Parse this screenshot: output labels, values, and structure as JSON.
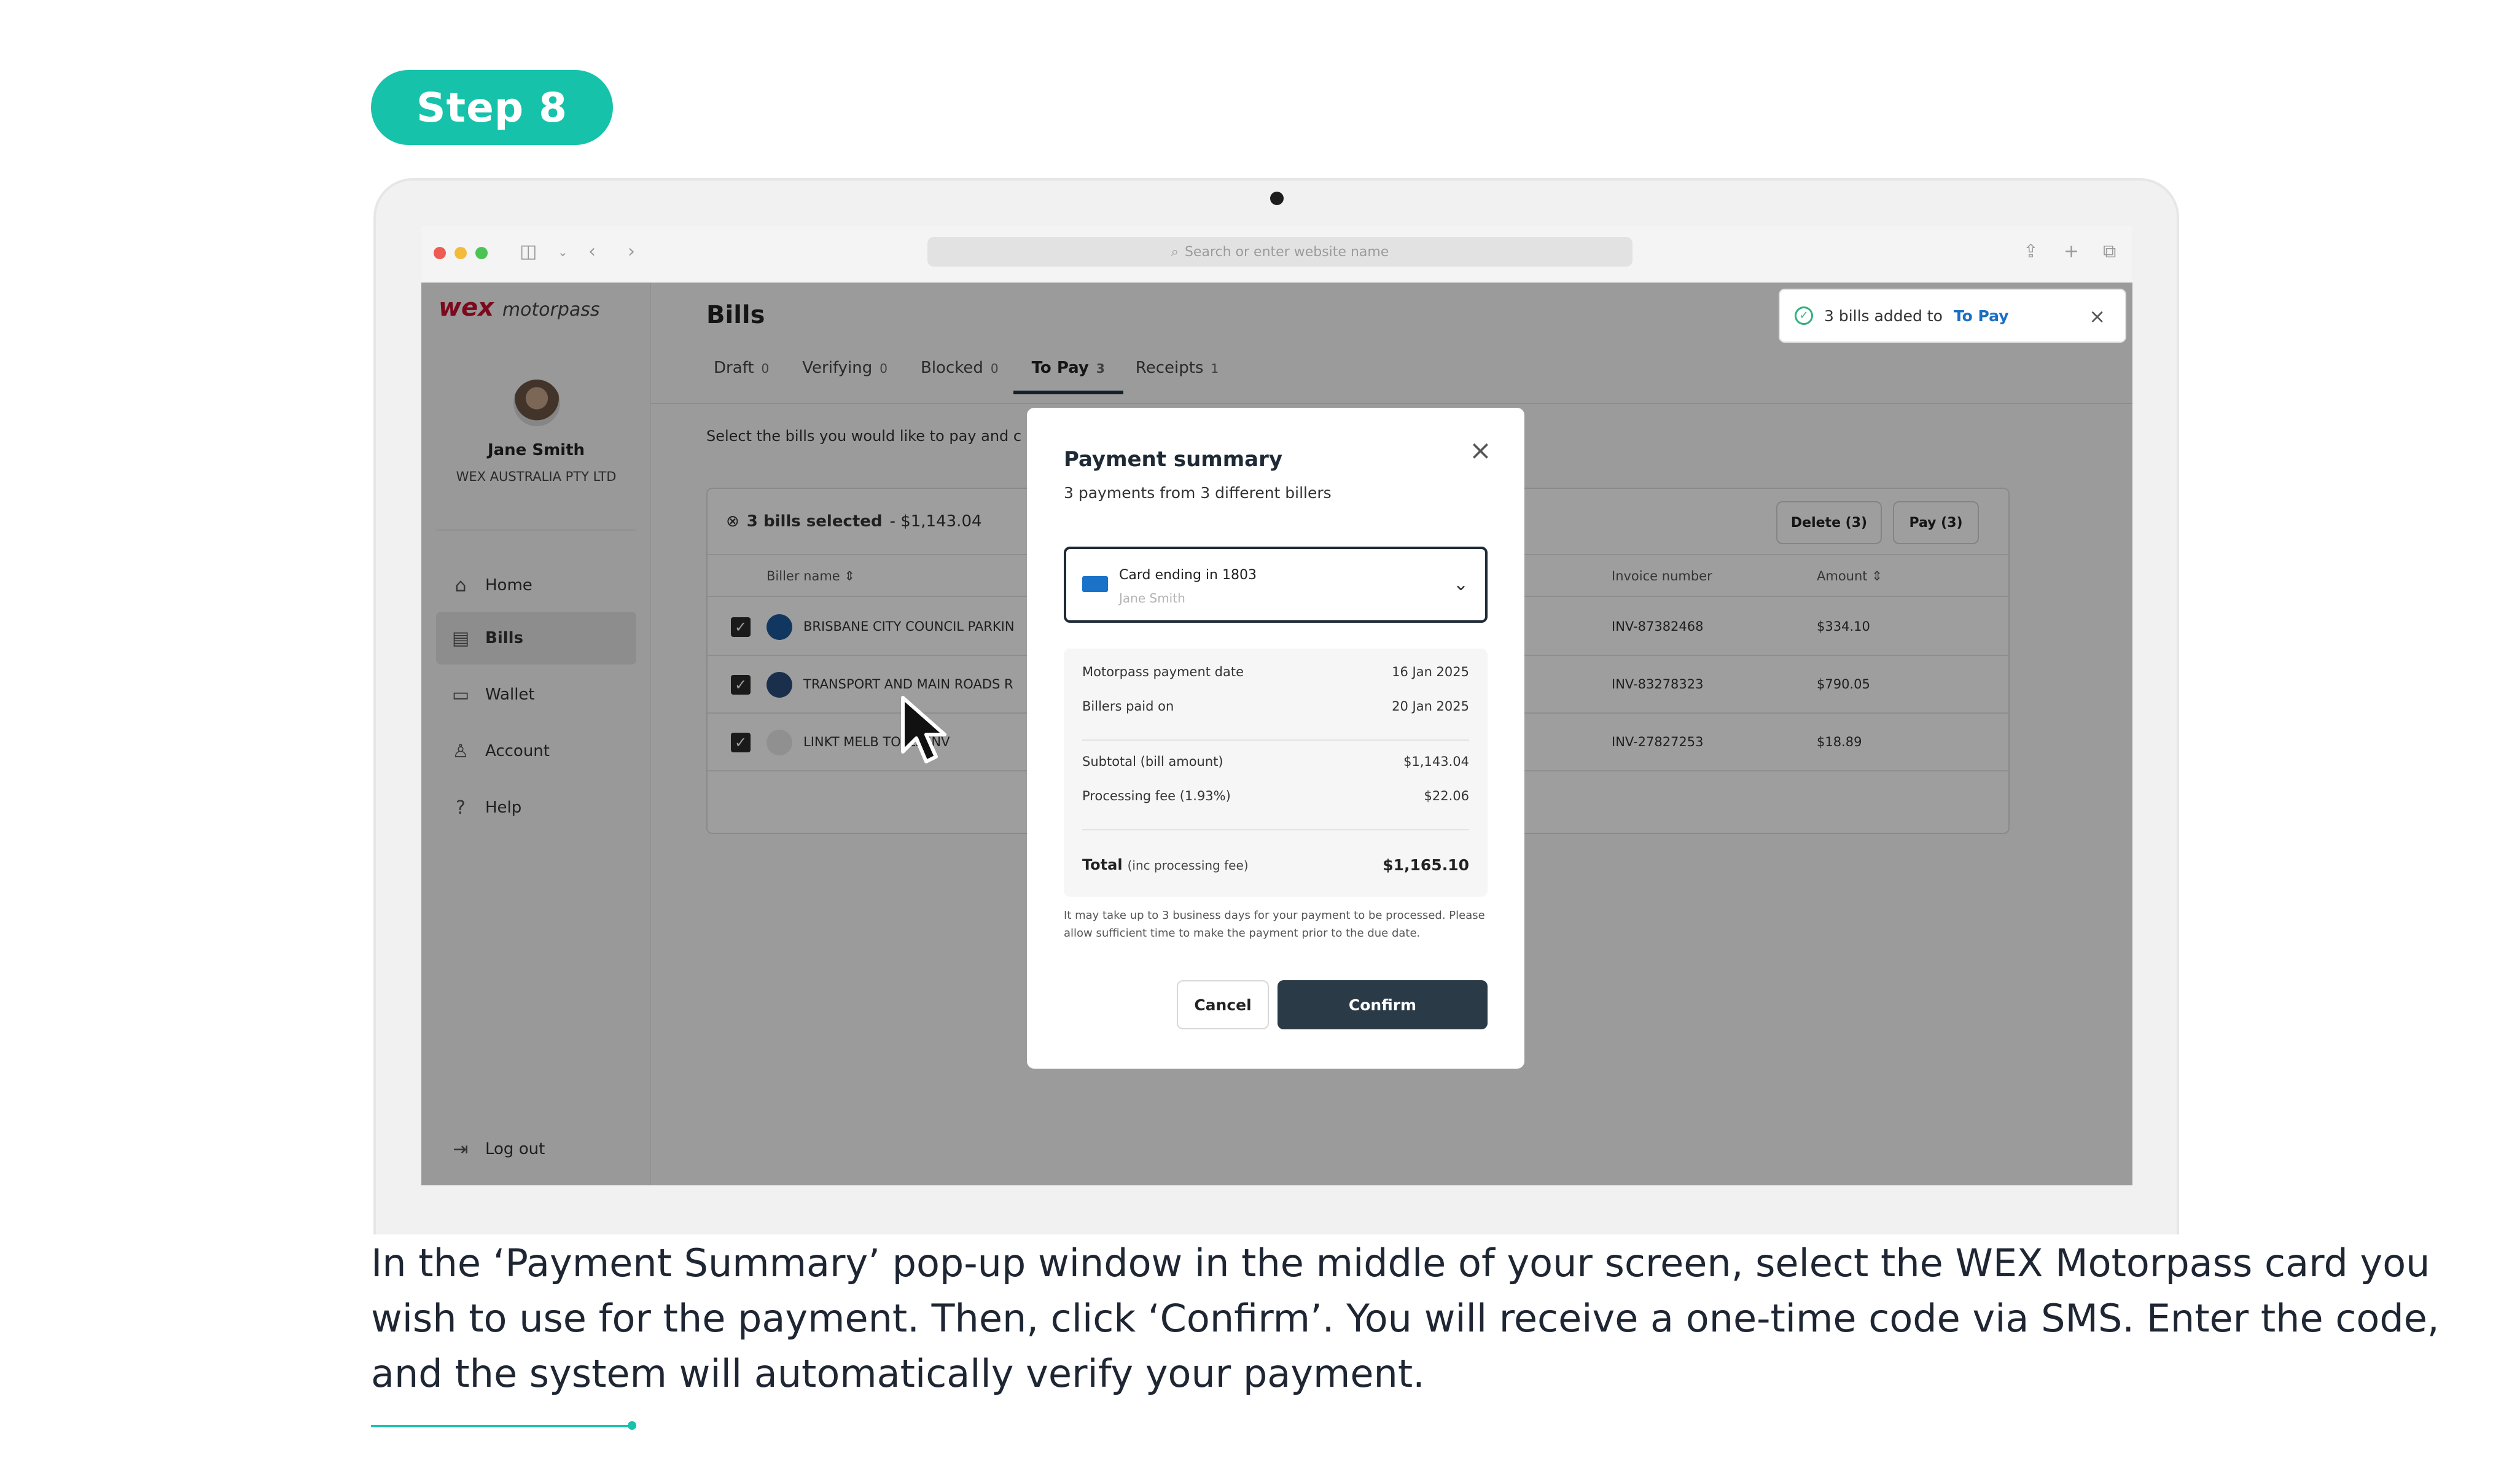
{
  "step": {
    "label": "Step 8"
  },
  "browser": {
    "address_placeholder": "Search or enter website name"
  },
  "brand": {
    "logo_main": "wex",
    "logo_sub": "motorpass"
  },
  "user": {
    "name": "Jane Smith",
    "org": "WEX AUSTRALIA PTY LTD"
  },
  "sidebar": {
    "items": [
      {
        "label": "Home",
        "icon": "home-icon",
        "glyph": "⌂"
      },
      {
        "label": "Bills",
        "icon": "document-icon",
        "glyph": "▤"
      },
      {
        "label": "Wallet",
        "icon": "wallet-icon",
        "glyph": "▭"
      },
      {
        "label": "Account",
        "icon": "user-icon",
        "glyph": "♙"
      },
      {
        "label": "Help",
        "icon": "help-icon",
        "glyph": "?"
      }
    ],
    "logout": "Log out"
  },
  "page": {
    "title": "Bills",
    "select_text": "Select the bills you would like to pay and c"
  },
  "tabs": [
    {
      "label": "Draft",
      "count": "0"
    },
    {
      "label": "Verifying",
      "count": "0"
    },
    {
      "label": "Blocked",
      "count": "0"
    },
    {
      "label": "To Pay",
      "count": "3"
    },
    {
      "label": "Receipts",
      "count": "1"
    }
  ],
  "table": {
    "selected_label": "3 bills selected",
    "selected_amount": "- $1,143.04",
    "delete_button": "Delete (3)",
    "pay_button": "Pay (3)",
    "headers": {
      "biller": "Biller name",
      "invoice": "Invoice number",
      "amount": "Amount"
    },
    "rows": [
      {
        "biller": "BRISBANE CITY COUNCIL PARKIN",
        "invoice": "INV-87382468",
        "amount": "$334.10"
      },
      {
        "biller": "TRANSPORT AND MAIN ROADS R",
        "invoice": "INV-83278323",
        "amount": "$790.05"
      },
      {
        "biller": "LINKT MELB TOLLS INV",
        "invoice": "INV-27827253",
        "amount": "$18.89"
      }
    ]
  },
  "toast": {
    "text": "3 bills added to",
    "link": "To Pay"
  },
  "modal": {
    "title": "Payment summary",
    "subtitle": "3 payments from 3 different billers",
    "card_label": "Card ending in 1803",
    "card_holder": "Jane Smith",
    "rows": [
      {
        "label": "Motorpass payment date",
        "value": "16 Jan 2025"
      },
      {
        "label": "Billers paid on",
        "value": "20 Jan 2025"
      },
      {
        "label": "Subtotal (bill amount)",
        "value": "$1,143.04"
      },
      {
        "label": "Processing fee (1.93%)",
        "value": "$22.06"
      }
    ],
    "total_label": "Total",
    "total_note": "(inc processing fee)",
    "total_value": "$1,165.10",
    "note": "It may take up to 3 business days for your payment to be processed. Please allow sufficient time to make the payment prior to the due date.",
    "cancel": "Cancel",
    "confirm": "Confirm"
  },
  "caption": "In the ‘Payment Summary’ pop-up window in the middle of your screen, select the WEX Motorpass card you wish to use for the payment. Then, click ‘Confirm’. You will receive a one-time code via SMS. Enter the code, and the system will automatically verify your payment.",
  "colors": {
    "accent": "#17c2ab",
    "confirm": "#2a3a47",
    "link": "#1a6fc4"
  }
}
